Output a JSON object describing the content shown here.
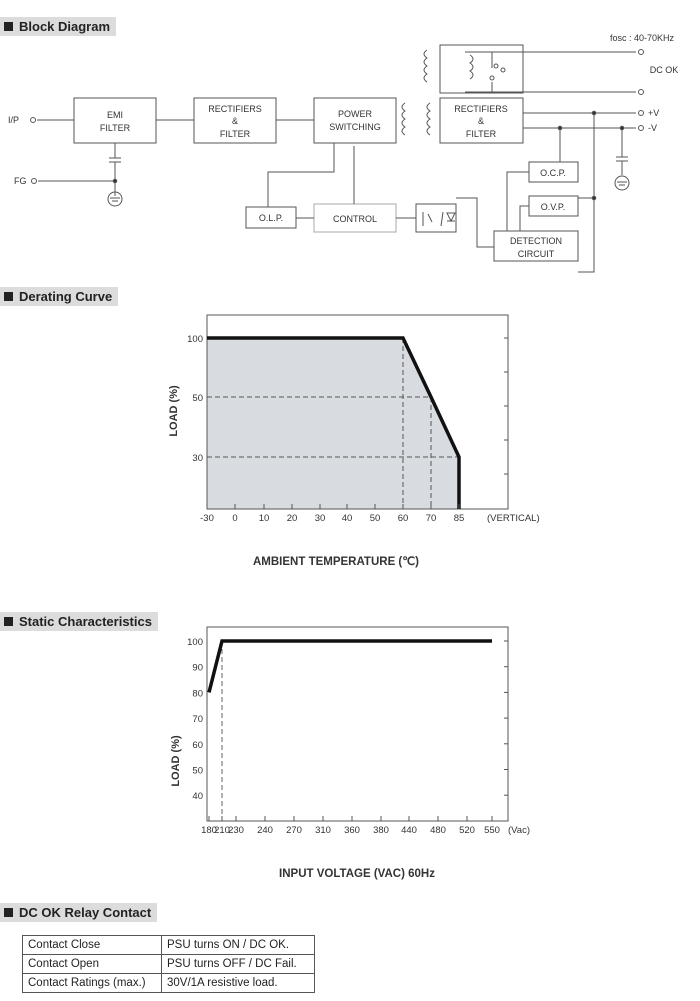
{
  "sections": {
    "block": "Block Diagram",
    "derating": "Derating Curve",
    "static": "Static Characteristics",
    "relay": "DC OK Relay Contact"
  },
  "block_diagram": {
    "fosc": "fosc : 40-70KHz",
    "dc_ok": "DC OK",
    "ip": "I/P",
    "fg": "FG",
    "plus_v": "+V",
    "minus_v": "-V",
    "emi": [
      "EMI",
      "FILTER"
    ],
    "rect1": [
      "RECTIFIERS",
      "&",
      "FILTER"
    ],
    "power": [
      "POWER",
      "SWITCHING"
    ],
    "rect2": [
      "RECTIFIERS",
      "&",
      "FILTER"
    ],
    "olp": "O.L.P.",
    "control": "CONTROL",
    "ocp": "O.C.P.",
    "ovp": "O.V.P.",
    "detection": [
      "DETECTION",
      "CIRCUIT"
    ]
  },
  "chart_data": [
    {
      "type": "area",
      "title": "",
      "xlabel": "AMBIENT TEMPERATURE (℃)",
      "ylabel": "LOAD (%)",
      "x_ticks": [
        "-30",
        "0",
        "10",
        "20",
        "30",
        "40",
        "50",
        "60",
        "70",
        "85"
      ],
      "x_note": "(VERTICAL)",
      "y_ticks": [
        "100",
        "50",
        "30"
      ],
      "x": [
        -30,
        60,
        70,
        85,
        85
      ],
      "y": [
        100,
        100,
        50,
        30,
        0
      ],
      "fill": "#d8dbe0",
      "grid": "dashed reference lines at 60,70,85 / 50,30"
    },
    {
      "type": "line",
      "title": "",
      "xlabel": "INPUT VOLTAGE (VAC) 60Hz",
      "ylabel": "LOAD (%)",
      "x_ticks": [
        "180",
        "210",
        "230",
        "240",
        "270",
        "310",
        "360",
        "380",
        "440",
        "480",
        "520",
        "550"
      ],
      "x_unit": "(Vac)",
      "y_ticks": [
        "100",
        "90",
        "80",
        "70",
        "60",
        "50",
        "40"
      ],
      "x": [
        180,
        210,
        550
      ],
      "y": [
        80,
        100,
        100
      ],
      "grid": "dashed reference at 210"
    }
  ],
  "relay_table": [
    [
      "Contact Close",
      "PSU turns ON / DC OK."
    ],
    [
      "Contact Open",
      "PSU turns OFF / DC Fail."
    ],
    [
      "Contact Ratings (max.)",
      "30V/1A resistive load."
    ]
  ]
}
